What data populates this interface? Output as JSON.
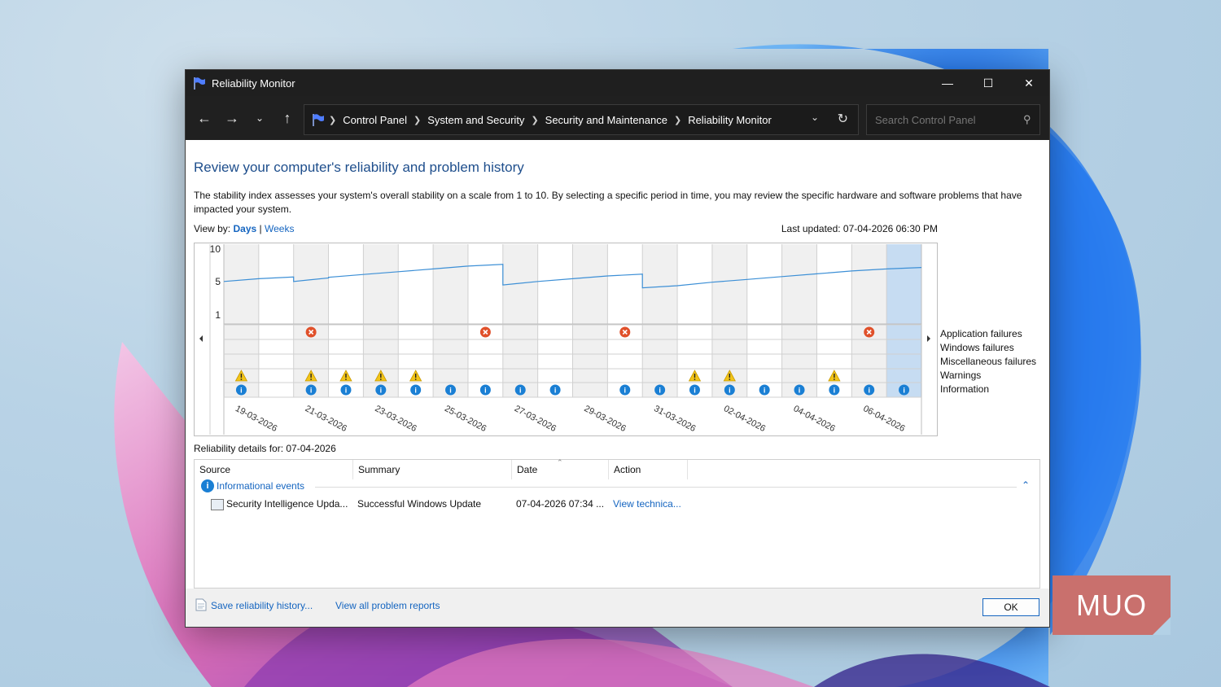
{
  "window": {
    "title": "Reliability Monitor"
  },
  "nav": {
    "breadcrumbs": [
      "Control Panel",
      "System and Security",
      "Security and Maintenance",
      "Reliability Monitor"
    ],
    "search_placeholder": "Search Control Panel"
  },
  "main": {
    "heading": "Review your computer's reliability and problem history",
    "description": "The stability index assesses your system's overall stability on a scale from 1 to 10. By selecting a specific period in time, you may review the specific hardware and software problems that have impacted your system.",
    "view_by_label": "View by:",
    "view_days": "Days",
    "view_sep": "|",
    "view_weeks": "Weeks",
    "last_updated": "Last updated: 07-04-2026 06:30 PM"
  },
  "chart_data": {
    "type": "line",
    "y_ticks": [
      "10",
      "5",
      "1"
    ],
    "ylim": [
      0,
      10
    ],
    "x_labels": [
      "19-03-2026",
      "21-03-2026",
      "23-03-2026",
      "25-03-2026",
      "27-03-2026",
      "29-03-2026",
      "31-03-2026",
      "02-04-2026",
      "04-04-2026",
      "06-04-2026"
    ],
    "columns": 20,
    "stability_index": [
      5.6,
      6.0,
      5.6,
      6.2,
      6.6,
      7.0,
      7.4,
      7.8,
      5.1,
      5.6,
      6.0,
      6.4,
      4.7,
      5.0,
      5.5,
      5.9,
      6.3,
      6.7,
      7.1,
      7.4
    ],
    "application_failures": [
      2,
      7,
      11,
      18
    ],
    "warnings": [
      0,
      2,
      3,
      4,
      5,
      13,
      14,
      17
    ],
    "information": [
      0,
      2,
      3,
      4,
      5,
      6,
      7,
      8,
      9,
      11,
      12,
      13,
      14,
      15,
      16,
      17,
      18,
      19
    ],
    "selected_column": 19,
    "legend": [
      "Application failures",
      "Windows failures",
      "Miscellaneous failures",
      "Warnings",
      "Information"
    ]
  },
  "details": {
    "label": "Reliability details for: 07-04-2026",
    "columns": [
      "Source",
      "Summary",
      "Date",
      "Action"
    ],
    "group": "Informational events",
    "rows": [
      {
        "source": "Security Intelligence Upda...",
        "summary": "Successful Windows Update",
        "date": "07-04-2026 07:34 ...",
        "action": "View technica..."
      }
    ]
  },
  "footer": {
    "save": "Save reliability history...",
    "view_all": "View all problem reports",
    "ok": "OK"
  },
  "watermark": "MUO",
  "colors": {
    "accent": "#1565c0",
    "heading": "#1e4e8c",
    "error": "#e0502a",
    "warning": "#f2c418",
    "info": "#1a7fd4",
    "selected": "#c6dcf2"
  }
}
